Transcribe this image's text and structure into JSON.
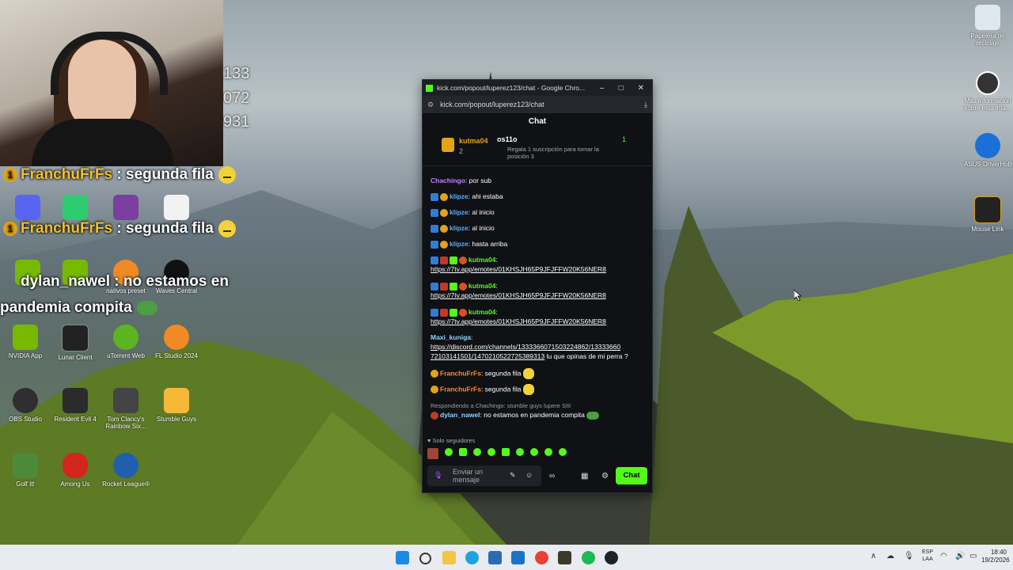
{
  "overlay": {
    "numbers": [
      "133",
      "072",
      "931"
    ],
    "messages": [
      {
        "user": "FranchuFrFs",
        "text": " : segunda fila"
      },
      {
        "user": "FranchuFrFs",
        "text": " : segunda fila"
      },
      {
        "user": "dylan_nawel",
        "text": " : no estamos en"
      },
      {
        "user": "",
        "text": "pandemia compita"
      }
    ]
  },
  "desktop_icons": [
    {
      "label": "Papelera de reciclaje",
      "icon": "recycle-bin-icon"
    },
    {
      "label": "Más información sobre esta ima...",
      "icon": "info-icon"
    },
    {
      "label": "ASUS DriverHub",
      "icon": "asus-icon"
    },
    {
      "label": "Mouse Link",
      "icon": "mouse-link-icon"
    },
    {
      "label": "NVIDIA App",
      "icon": "nvidia-icon"
    },
    {
      "label": "Lunar Client",
      "icon": "lunar-icon"
    },
    {
      "label": "uTorrent Web",
      "icon": "utorrent-icon"
    },
    {
      "label": "FL Studio 2024",
      "icon": "flstudio-icon"
    },
    {
      "label": "OBS Studio",
      "icon": "obs-icon"
    },
    {
      "label": "Resident Evil 4",
      "icon": "re4-icon"
    },
    {
      "label": "Tom Clancy's Rainbow Six...",
      "icon": "r6-icon"
    },
    {
      "label": "Stumble Guys",
      "icon": "stumble-icon"
    },
    {
      "label": "Golf It!",
      "icon": "golf-icon"
    },
    {
      "label": "Among Us",
      "icon": "among-icon"
    },
    {
      "label": "Rocket League®",
      "icon": "rocket-icon"
    },
    {
      "label": "nativos preset",
      "icon": "fl-icon"
    },
    {
      "label": "Waves Central",
      "icon": "waves-icon"
    }
  ],
  "browser": {
    "title": "kick.com/popout/luperez123/chat - Google Chro...",
    "url": "kick.com/popout/luperez123/chat",
    "chat_title": "Chat"
  },
  "pinned": {
    "top_user": "kutma04",
    "top_count": "2",
    "second_user": "os11o",
    "second_count": "1",
    "note": "Regala 1 suscripción para tomar la posición 3"
  },
  "messages": [
    {
      "user": "Chachingo",
      "text": ": por sub"
    },
    {
      "user": "klipze",
      "text": ": ahi estaba"
    },
    {
      "user": "klipze",
      "text": ": al inicio"
    },
    {
      "user": "klipze",
      "text": ": al inicio"
    },
    {
      "user": "klipze",
      "text": ": hasta arriba"
    },
    {
      "user": "kutma04",
      "text": ":",
      "link": "https://7tv.app/emotes/01KHSJH65P9JFJFFW20K56NER8"
    },
    {
      "user": "kutma04",
      "text": ":",
      "link": "https://7tv.app/emotes/01KHSJH65P9JFJFFW20K56NER8"
    },
    {
      "user": "kutma04",
      "text": ":",
      "link": "https://7tv.app/emotes/01KHSJH65P9JFJFFW20K56NER8"
    },
    {
      "user": "Maxi_kuniga",
      "text": ":",
      "link1": "https://discord.com/channels/1333366071503224862/13333660",
      "link2": "72103141501/1470210522725389313",
      "after": " lu que opinas de mi perra ?"
    },
    {
      "user": "FranchuFrFs",
      "text": ": segunda fila"
    },
    {
      "user": "FranchuFrFs",
      "text": ": segunda fila"
    },
    {
      "reply": "Respondiendo a Chachingo: stumble guys lupere SIII",
      "user": "dylan_nawel",
      "text": ": no estamos en pandemia compita"
    }
  ],
  "footer": {
    "followers_only": "Solo seguidores",
    "placeholder": "Enviar un mensaje",
    "chat_button": "Chat"
  },
  "taskbar": {
    "lang1": "ESP",
    "lang2": "LAA",
    "time": "18:40",
    "date": "19/2/2026"
  }
}
